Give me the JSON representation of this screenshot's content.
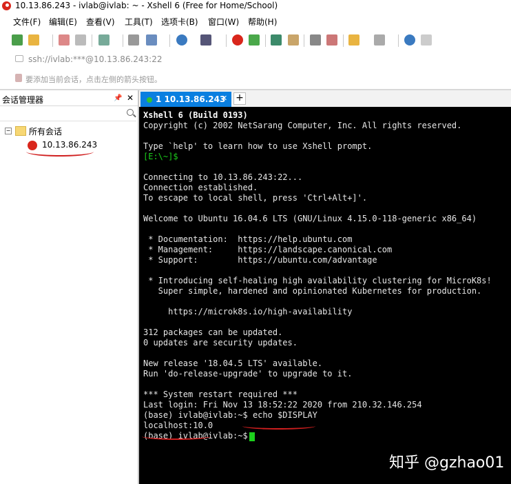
{
  "window": {
    "title": "10.13.86.243 - ivlab@ivlab: ~ - Xshell 6 (Free for Home/School)"
  },
  "menu": [
    "文件(F)",
    "编辑(E)",
    "查看(V)",
    "工具(T)",
    "选项卡(B)",
    "窗口(W)",
    "帮助(H)"
  ],
  "address_bar": {
    "value": "ssh://ivlab:***@10.13.86.243:22"
  },
  "hint_bar": {
    "text": "要添加当前会话，点击左侧的箭头按钮。"
  },
  "session_manager": {
    "title": "会话管理器",
    "pin_icon": "pin-icon",
    "close_icon": "close-icon",
    "search_icon": "search-icon",
    "tree_root": "所有会话",
    "sessions": [
      "10.13.86.243"
    ]
  },
  "tabs": [
    {
      "label": "1 10.13.86.243",
      "active": true
    }
  ],
  "terminal": {
    "lines": [
      {
        "text": "Xshell 6 (Build 0193)",
        "bold": true
      },
      {
        "text": "Copyright (c) 2002 NetSarang Computer, Inc. All rights reserved."
      },
      {
        "text": ""
      },
      {
        "text": "Type `help' to learn how to use Xshell prompt."
      },
      {
        "text": "[E:\\~]$",
        "color": "#1cd01c"
      },
      {
        "text": ""
      },
      {
        "text": "Connecting to 10.13.86.243:22..."
      },
      {
        "text": "Connection established."
      },
      {
        "text": "To escape to local shell, press 'Ctrl+Alt+]'."
      },
      {
        "text": ""
      },
      {
        "text": "Welcome to Ubuntu 16.04.6 LTS (GNU/Linux 4.15.0-118-generic x86_64)"
      },
      {
        "text": ""
      },
      {
        "text": " * Documentation:  https://help.ubuntu.com"
      },
      {
        "text": " * Management:     https://landscape.canonical.com"
      },
      {
        "text": " * Support:        https://ubuntu.com/advantage"
      },
      {
        "text": ""
      },
      {
        "text": " * Introducing self-healing high availability clustering for MicroK8s!"
      },
      {
        "text": "   Super simple, hardened and opinionated Kubernetes for production."
      },
      {
        "text": ""
      },
      {
        "text": "     https://microk8s.io/high-availability"
      },
      {
        "text": ""
      },
      {
        "text": "312 packages can be updated."
      },
      {
        "text": "0 updates are security updates."
      },
      {
        "text": ""
      },
      {
        "text": "New release '18.04.5 LTS' available."
      },
      {
        "text": "Run 'do-release-upgrade' to upgrade to it."
      },
      {
        "text": ""
      },
      {
        "text": "*** System restart required ***"
      },
      {
        "text": "Last login: Fri Nov 13 18:52:22 2020 from 210.32.146.254"
      },
      {
        "text": "(base) ivlab@ivlab:~$ echo $DISPLAY"
      },
      {
        "text": "localhost:10.0"
      },
      {
        "text": "(base) ivlab@ivlab:~$ "
      }
    ]
  },
  "watermark": "知乎 @gzhao01",
  "colors": {
    "tab_active": "#0a7fe0",
    "terminal_bg": "#000000",
    "prompt_green": "#1cd01c",
    "annotation_red": "#d01f1f"
  }
}
